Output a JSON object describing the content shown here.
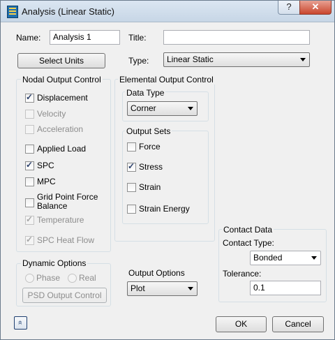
{
  "window": {
    "title": "Analysis (Linear Static)",
    "help_label": "?",
    "close_label": "✕"
  },
  "header": {
    "name_label": "Name:",
    "name_value": "Analysis 1",
    "title_label": "Title:",
    "title_value": "",
    "select_units_label": "Select Units",
    "type_label": "Type:",
    "type_value": "Linear Static"
  },
  "nodal": {
    "label": "Nodal Output Control",
    "items": [
      {
        "label": "Displacement",
        "checked": true,
        "enabled": true
      },
      {
        "label": "Velocity",
        "checked": false,
        "enabled": false
      },
      {
        "label": "Acceleration",
        "checked": false,
        "enabled": false
      },
      {
        "label": "Applied Load",
        "checked": false,
        "enabled": true
      },
      {
        "label": "SPC",
        "checked": true,
        "enabled": true
      },
      {
        "label": "MPC",
        "checked": false,
        "enabled": true
      },
      {
        "label": "Grid Point Force",
        "label2": "Balance",
        "checked": false,
        "enabled": true
      },
      {
        "label": "Temperature",
        "checked": true,
        "enabled": false
      },
      {
        "label": "SPC Heat Flow",
        "checked": true,
        "enabled": false
      }
    ]
  },
  "elemental": {
    "label": "Elemental Output Control",
    "data_type_label": "Data Type",
    "data_type_value": "Corner",
    "output_sets_label": "Output Sets",
    "sets": [
      {
        "label": "Force",
        "checked": false
      },
      {
        "label": "Stress",
        "checked": true
      },
      {
        "label": "Strain",
        "checked": false
      },
      {
        "label": "Strain Energy",
        "checked": false
      }
    ]
  },
  "dynamic": {
    "label": "Dynamic Options",
    "phase_label": "Phase",
    "real_label": "Real",
    "psd_label": "PSD Output Control"
  },
  "output_options": {
    "label": "Output Options",
    "value": "Plot"
  },
  "contact": {
    "label": "Contact Data",
    "type_label": "Contact Type:",
    "type_value": "Bonded",
    "tolerance_label": "Tolerance:",
    "tolerance_value": "0.1"
  },
  "footer": {
    "expand_label": "»",
    "ok_label": "OK",
    "cancel_label": "Cancel"
  }
}
